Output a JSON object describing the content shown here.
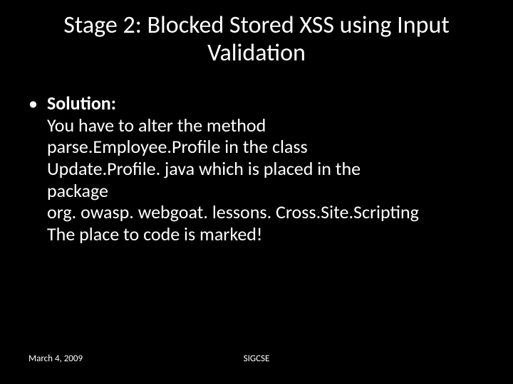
{
  "slide": {
    "title": "Stage 2: Blocked Stored XSS using Input Validation",
    "bullet_label": "Solution:",
    "bullet_body": "You have to alter the method\nparse.Employee.Profile in the class\nUpdate.Profile. java which is placed in the\npackage\norg. owasp. webgoat. lessons. Cross.Site.Scripting\nThe place to code is marked!"
  },
  "footer": {
    "date": "March 4, 2009",
    "center": "SIGCSE"
  }
}
